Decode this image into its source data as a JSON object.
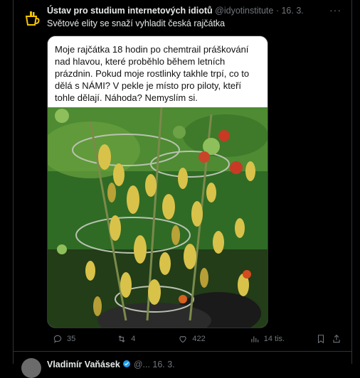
{
  "tweet": {
    "author_name": "Ústav pro studium internetových idiotů",
    "handle": "@idyotinstitute",
    "separator": "·",
    "date": "16. 3.",
    "text": "Světové elity se snaží vyhladit česká rajčátka",
    "more_icon": "more-icon",
    "media": {
      "caption": "Moje rajčátka 18 hodin po chemtrail práškování nad hlavou, které proběhlo během letních prázdnin. Pokud moje rostlinky takhle trpí, co to dělá s NÁMI? V pekle je místo pro piloty, kteří tohle dělají. Náhoda? Nemyslím si."
    },
    "actions": {
      "replies": "35",
      "retweets": "4",
      "likes": "422",
      "views": "14 tis."
    }
  },
  "next_tweet": {
    "author_name": "Vladimír Vaňásek",
    "handle": "@...",
    "date": "16. 3."
  },
  "colors": {
    "background": "#000000",
    "text": "#e7e9ea",
    "muted": "#71767b",
    "divider": "#2f3336",
    "verified": "#1d9bf0"
  }
}
